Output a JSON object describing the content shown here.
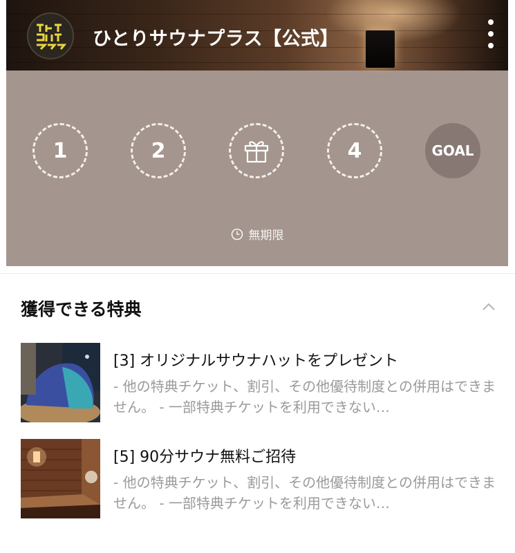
{
  "header": {
    "title": "ひとりサウナプラス【公式】",
    "logo_icon": "brand-logo-icon",
    "menu_icon": "kebab-menu-icon"
  },
  "stampcard": {
    "stamps": [
      {
        "label": "1",
        "state": "empty"
      },
      {
        "label": "2",
        "state": "empty"
      },
      {
        "label": "",
        "state": "reward",
        "icon": "gift-icon"
      },
      {
        "label": "4",
        "state": "empty"
      },
      {
        "label": "GOAL",
        "state": "goal"
      }
    ],
    "expiry_icon": "clock-icon",
    "expiry_text": "無期限",
    "colors": {
      "card_bg": "#a4958e",
      "goal_bg": "#887873"
    }
  },
  "rewards": {
    "title": "獲得できる特典",
    "collapse_icon": "chevron-up-icon",
    "items": [
      {
        "name": "[3] オリジナルサウナハットをプレゼント",
        "description": "- 他の特典チケット、割引、その他優待制度との併用はできません。 - 一部特典チケットを利用できない…",
        "thumbnail": "sauna-hat-photo"
      },
      {
        "name": "[5] 90分サウナ無料ご招待",
        "description": "- 他の特典チケット、割引、その他優待制度との併用はできません。 - 一部特典チケットを利用できない…",
        "thumbnail": "sauna-room-photo"
      }
    ]
  }
}
